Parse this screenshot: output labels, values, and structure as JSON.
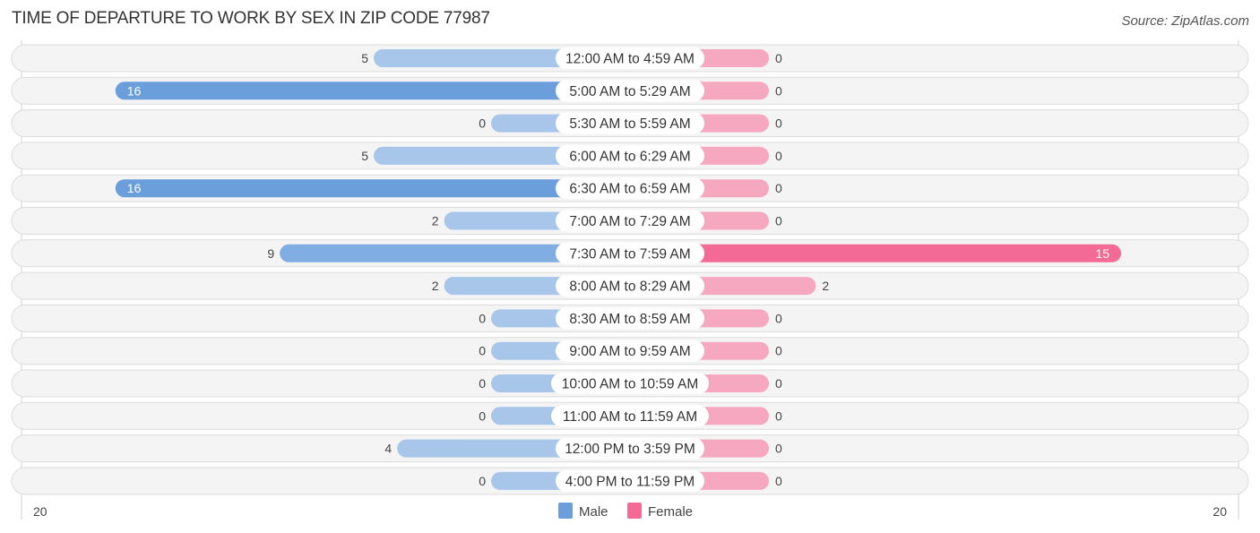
{
  "chart_data": {
    "type": "bar",
    "orientation": "horizontal-diverging",
    "title": "TIME OF DEPARTURE TO WORK BY SEX IN ZIP CODE 77987",
    "source": "Source: ZipAtlas.com",
    "categories": [
      "12:00 AM to 4:59 AM",
      "5:00 AM to 5:29 AM",
      "5:30 AM to 5:59 AM",
      "6:00 AM to 6:29 AM",
      "6:30 AM to 6:59 AM",
      "7:00 AM to 7:29 AM",
      "7:30 AM to 7:59 AM",
      "8:00 AM to 8:29 AM",
      "8:30 AM to 8:59 AM",
      "9:00 AM to 9:59 AM",
      "10:00 AM to 10:59 AM",
      "11:00 AM to 11:59 AM",
      "12:00 PM to 3:59 PM",
      "4:00 PM to 11:59 PM"
    ],
    "series": [
      {
        "name": "Male",
        "color": "#6a9fdb",
        "color_light": "#a7c6ea",
        "side": "left",
        "values": [
          5,
          16,
          0,
          5,
          16,
          2,
          9,
          2,
          0,
          0,
          0,
          0,
          4,
          0
        ]
      },
      {
        "name": "Female",
        "color": "#f26a95",
        "color_light": "#f6a8c1",
        "side": "right",
        "values": [
          0,
          0,
          0,
          0,
          0,
          0,
          15,
          2,
          0,
          0,
          0,
          0,
          0,
          0
        ]
      }
    ],
    "xlim": [
      20,
      20
    ],
    "axis_labels": {
      "left": "20",
      "right": "20"
    },
    "legend": {
      "position": "bottom-center",
      "items": [
        "Male",
        "Female"
      ]
    },
    "grid": false
  }
}
